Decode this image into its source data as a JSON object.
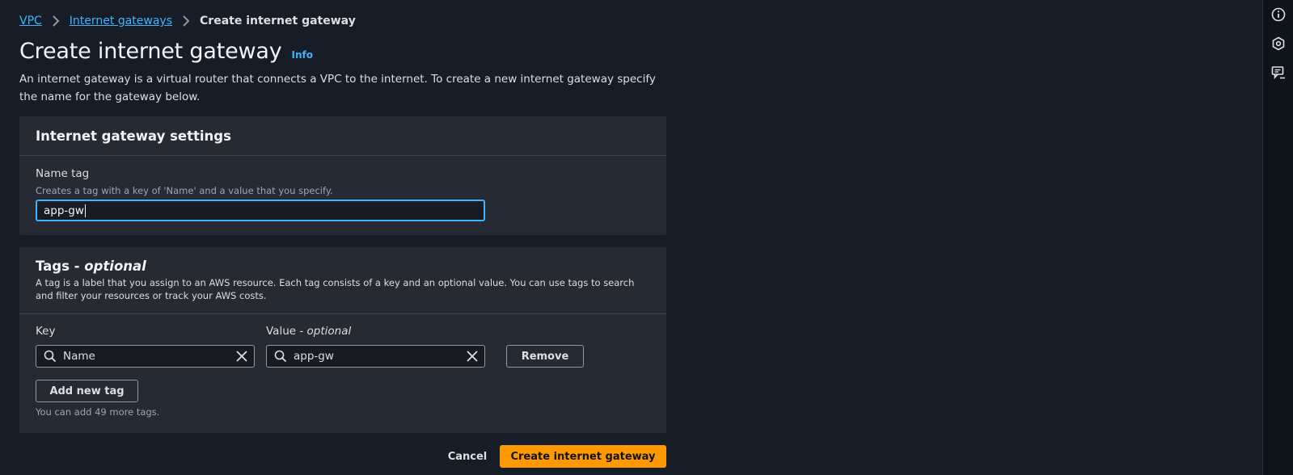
{
  "breadcrumb": {
    "items": [
      {
        "label": "VPC"
      },
      {
        "label": "Internet gateways"
      },
      {
        "label": "Create internet gateway"
      }
    ]
  },
  "page": {
    "title": "Create internet gateway",
    "info_label": "Info",
    "description": "An internet gateway is a virtual router that connects a VPC to the internet. To create a new internet gateway specify the name for the gateway below."
  },
  "settings_panel": {
    "title": "Internet gateway settings",
    "name_tag_label": "Name tag",
    "name_tag_hint": "Creates a tag with a key of 'Name' and a value that you specify.",
    "name_tag_value": "app-gw"
  },
  "tags_panel": {
    "title": "Tags -",
    "title_optional": "optional",
    "description": "A tag is a label that you assign to an AWS resource. Each tag consists of a key and an optional value. You can use tags to search and filter your resources or track your AWS costs.",
    "key_label": "Key",
    "value_label": "Value -",
    "value_label_optional": "optional",
    "rows": [
      {
        "key": "Name",
        "value": "app-gw"
      }
    ],
    "remove_label": "Remove",
    "add_label": "Add new tag",
    "footnote": "You can add 49 more tags."
  },
  "actions": {
    "cancel_label": "Cancel",
    "submit_label": "Create internet gateway"
  },
  "right_rail": {
    "icons": [
      "info-icon",
      "hexagon-settings-icon",
      "feedback-icon"
    ]
  },
  "colors": {
    "background": "#161d26",
    "panel": "#252a33",
    "link": "#42b4ff",
    "primary": "#ff9900",
    "focus_border": "#42b4ff"
  }
}
